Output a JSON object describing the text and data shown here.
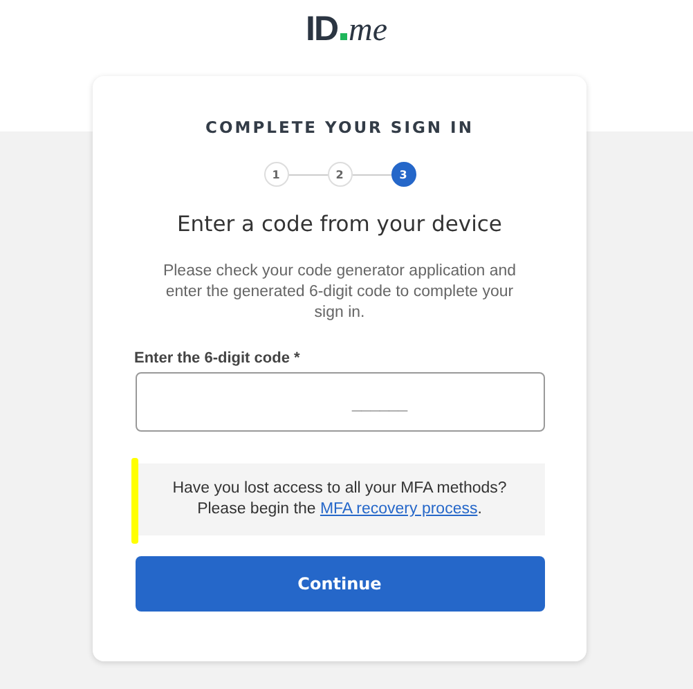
{
  "logo": {
    "bold": "ID",
    "italic": "me"
  },
  "card": {
    "heading": "COMPLETE YOUR SIGN IN",
    "steps": [
      {
        "label": "1",
        "selected": false
      },
      {
        "label": "2",
        "selected": false
      },
      {
        "label": "3",
        "selected": true
      }
    ],
    "title": "Enter a code from your device",
    "instructions": "Please check your code generator application and enter the generated 6-digit code to complete your sign in.",
    "code_field": {
      "label": "Enter the 6-digit code *",
      "placeholder": "______"
    },
    "recovery_notice": {
      "question": "Have you lost access to all your MFA methods?",
      "prefix": "Please begin the",
      "link": "MFA recovery process",
      "suffix": "."
    },
    "buttons": [
      "Continue"
    ]
  }
}
